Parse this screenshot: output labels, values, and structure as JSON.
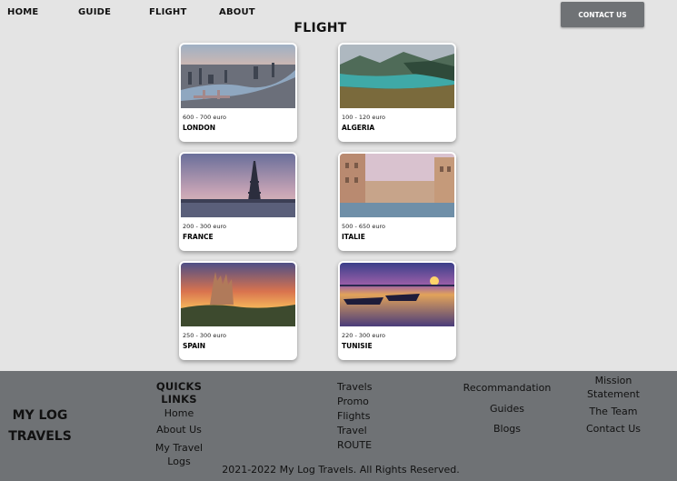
{
  "nav": {
    "home": "HOME",
    "guide": "GUIDE",
    "flight": "FLIGHT",
    "about": "ABOUT",
    "contact_button": "CONTACT US"
  },
  "page_title": "FLIGHT",
  "destinations": [
    {
      "price": "600 - 700 euro",
      "city": "LONDON"
    },
    {
      "price": "100 - 120 euro",
      "city": "ALGERIA"
    },
    {
      "price": "200 - 300 euro",
      "city": "FRANCE"
    },
    {
      "price": "500 - 650 euro",
      "city": "ITALIE"
    },
    {
      "price": "250 - 300 euro",
      "city": "SPAIN"
    },
    {
      "price": "220 - 300 euro",
      "city": "TUNISIE"
    }
  ],
  "footer": {
    "brand_line1": "MY LOG",
    "brand_line2": "TRAVELS",
    "quick_links_heading": "QUICKS LINKS",
    "quick_links": [
      "Home",
      "About Us",
      "My Travel",
      "Logs"
    ],
    "travel_links": [
      "Travels",
      "Promo",
      "Flights",
      "Travel",
      "ROUTE"
    ],
    "info_links": [
      "Recommandation",
      "Guides",
      "Blogs"
    ],
    "about_links": [
      "Mission",
      "Statement",
      "The Team",
      "Contact Us"
    ],
    "copyright": "2021-2022 My Log Travels. All Rights Reserved."
  },
  "colors": {
    "page_background": "#e4e4e4",
    "footer_background": "#6f7275",
    "contact_button": "#6f7275"
  }
}
